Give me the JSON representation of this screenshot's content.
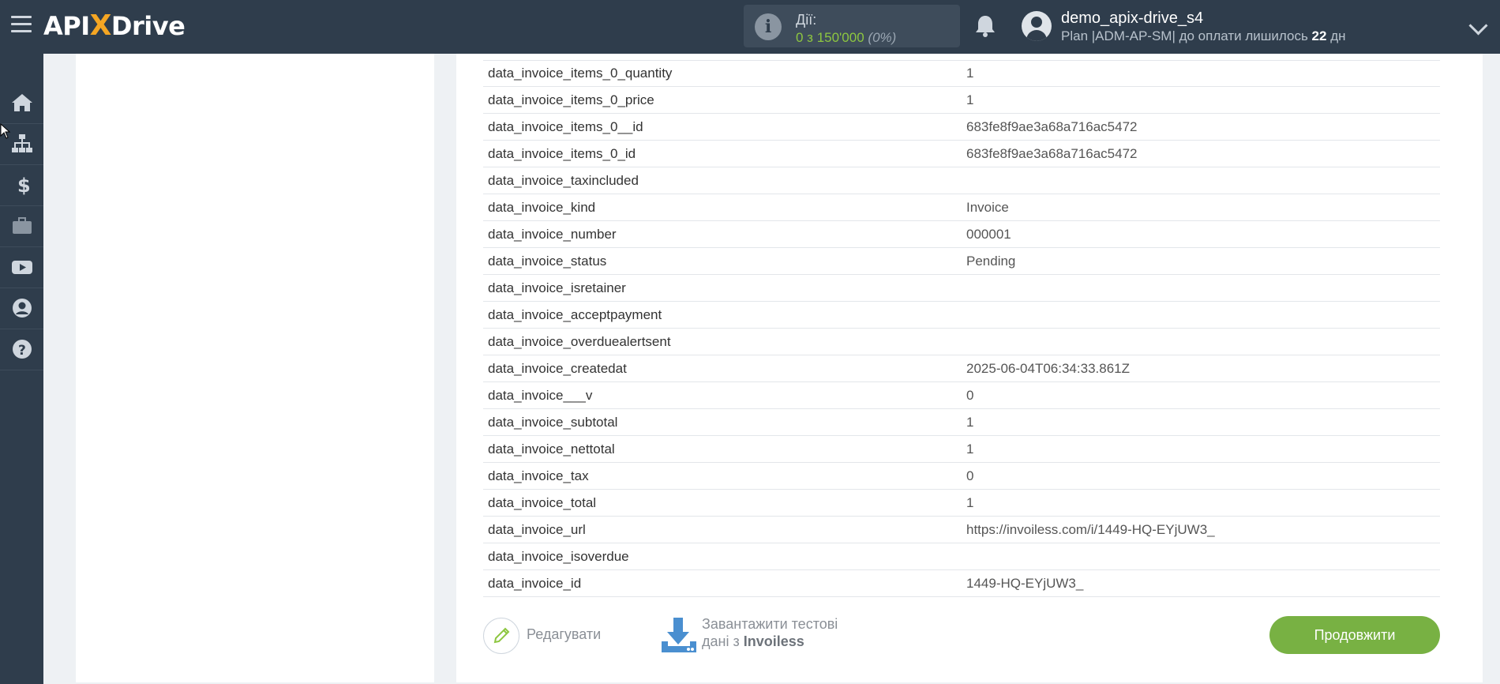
{
  "header": {
    "logo": {
      "api": "API",
      "x": "X",
      "drive": "Drive"
    },
    "actions": {
      "label": "Дії:",
      "value": "0 з 150'000",
      "percent": "(0%)"
    },
    "user": {
      "name": "demo_apix-drive_s4",
      "plan_prefix": "Plan |ADM-AP-SM| до оплати лишилось ",
      "days": "22",
      "days_suffix": " дн"
    }
  },
  "sidebar": {
    "items": [
      {
        "icon": "home-icon"
      },
      {
        "icon": "sitemap-icon"
      },
      {
        "icon": "dollar-icon"
      },
      {
        "icon": "briefcase-icon"
      },
      {
        "icon": "youtube-icon"
      },
      {
        "icon": "user-circle-icon"
      },
      {
        "icon": "help-icon"
      }
    ]
  },
  "fields": [
    {
      "key": "data_invoice_items_0_quantity",
      "value": "1"
    },
    {
      "key": "data_invoice_items_0_price",
      "value": "1"
    },
    {
      "key": "data_invoice_items_0__id",
      "value": "683fe8f9ae3a68a716ac5472"
    },
    {
      "key": "data_invoice_items_0_id",
      "value": "683fe8f9ae3a68a716ac5472"
    },
    {
      "key": "data_invoice_taxincluded",
      "value": ""
    },
    {
      "key": "data_invoice_kind",
      "value": "Invoice"
    },
    {
      "key": "data_invoice_number",
      "value": "000001"
    },
    {
      "key": "data_invoice_status",
      "value": "Pending"
    },
    {
      "key": "data_invoice_isretainer",
      "value": ""
    },
    {
      "key": "data_invoice_acceptpayment",
      "value": ""
    },
    {
      "key": "data_invoice_overduealertsent",
      "value": ""
    },
    {
      "key": "data_invoice_createdat",
      "value": "2025-06-04T06:34:33.861Z"
    },
    {
      "key": "data_invoice___v",
      "value": "0"
    },
    {
      "key": "data_invoice_subtotal",
      "value": "1"
    },
    {
      "key": "data_invoice_nettotal",
      "value": "1"
    },
    {
      "key": "data_invoice_tax",
      "value": "0"
    },
    {
      "key": "data_invoice_total",
      "value": "1"
    },
    {
      "key": "data_invoice_url",
      "value": "https://invoiless.com/i/1449-HQ-EYjUW3_"
    },
    {
      "key": "data_invoice_isoverdue",
      "value": ""
    },
    {
      "key": "data_invoice_id",
      "value": "1449-HQ-EYjUW3_"
    }
  ],
  "footer": {
    "edit_label": "Редагувати",
    "download_line1": "Завантажити тестові",
    "download_line2_prefix": "дані з ",
    "download_service": "Invoiless",
    "next_label": "Продовжити"
  },
  "colors": {
    "topbar": "#2f3d4c",
    "accent_green": "#78b143",
    "logo_x": "#f5a623",
    "download_icon": "#4a8fd0"
  }
}
